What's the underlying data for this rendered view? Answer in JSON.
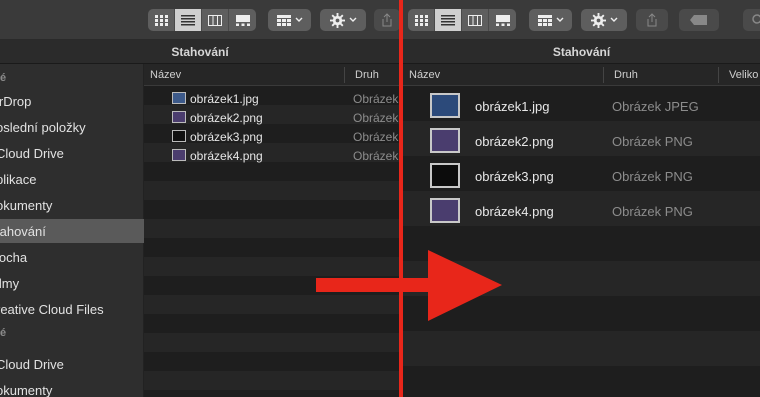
{
  "window": {
    "title": "Stahování"
  },
  "toolbar_icons": [
    "icon-view-icon",
    "list-view-icon",
    "column-view-icon",
    "gallery-view-icon",
    "group-icon",
    "action-gear-icon",
    "share-icon",
    "tag-icon",
    "search-icon"
  ],
  "sidebar": {
    "section_favorites": "é",
    "items": [
      {
        "label": "irDrop"
      },
      {
        "label": "oslední položky"
      },
      {
        "label": "Cloud Drive"
      },
      {
        "label": "plikace"
      },
      {
        "label": "okumenty"
      },
      {
        "label": "tahování"
      },
      {
        "label": "locha"
      },
      {
        "label": "ilmy"
      },
      {
        "label": "reative Cloud Files"
      }
    ],
    "section_icloud": "é",
    "icloud_items": [
      {
        "label": "Cloud Drive"
      },
      {
        "label": "okumenty"
      }
    ],
    "selected_index": 5
  },
  "columns": {
    "name": "Název",
    "kind": "Druh",
    "size": "Veliko"
  },
  "files": [
    {
      "name": "obrázek1.jpg",
      "kind_short": "Obrázek",
      "kind": "Obrázek JPEG"
    },
    {
      "name": "obrázek2.png",
      "kind_short": "Obrázek",
      "kind": "Obrázek PNG"
    },
    {
      "name": "obrázek3.png",
      "kind_short": "Obrázek",
      "kind": "Obrázek PNG"
    },
    {
      "name": "obrázek4.png",
      "kind_short": "Obrázek",
      "kind": "Obrázek PNG"
    }
  ],
  "colors": {
    "arrow": "#e8261a",
    "selection": "#5a5a5a",
    "toolbar": "#3a3a3a"
  }
}
